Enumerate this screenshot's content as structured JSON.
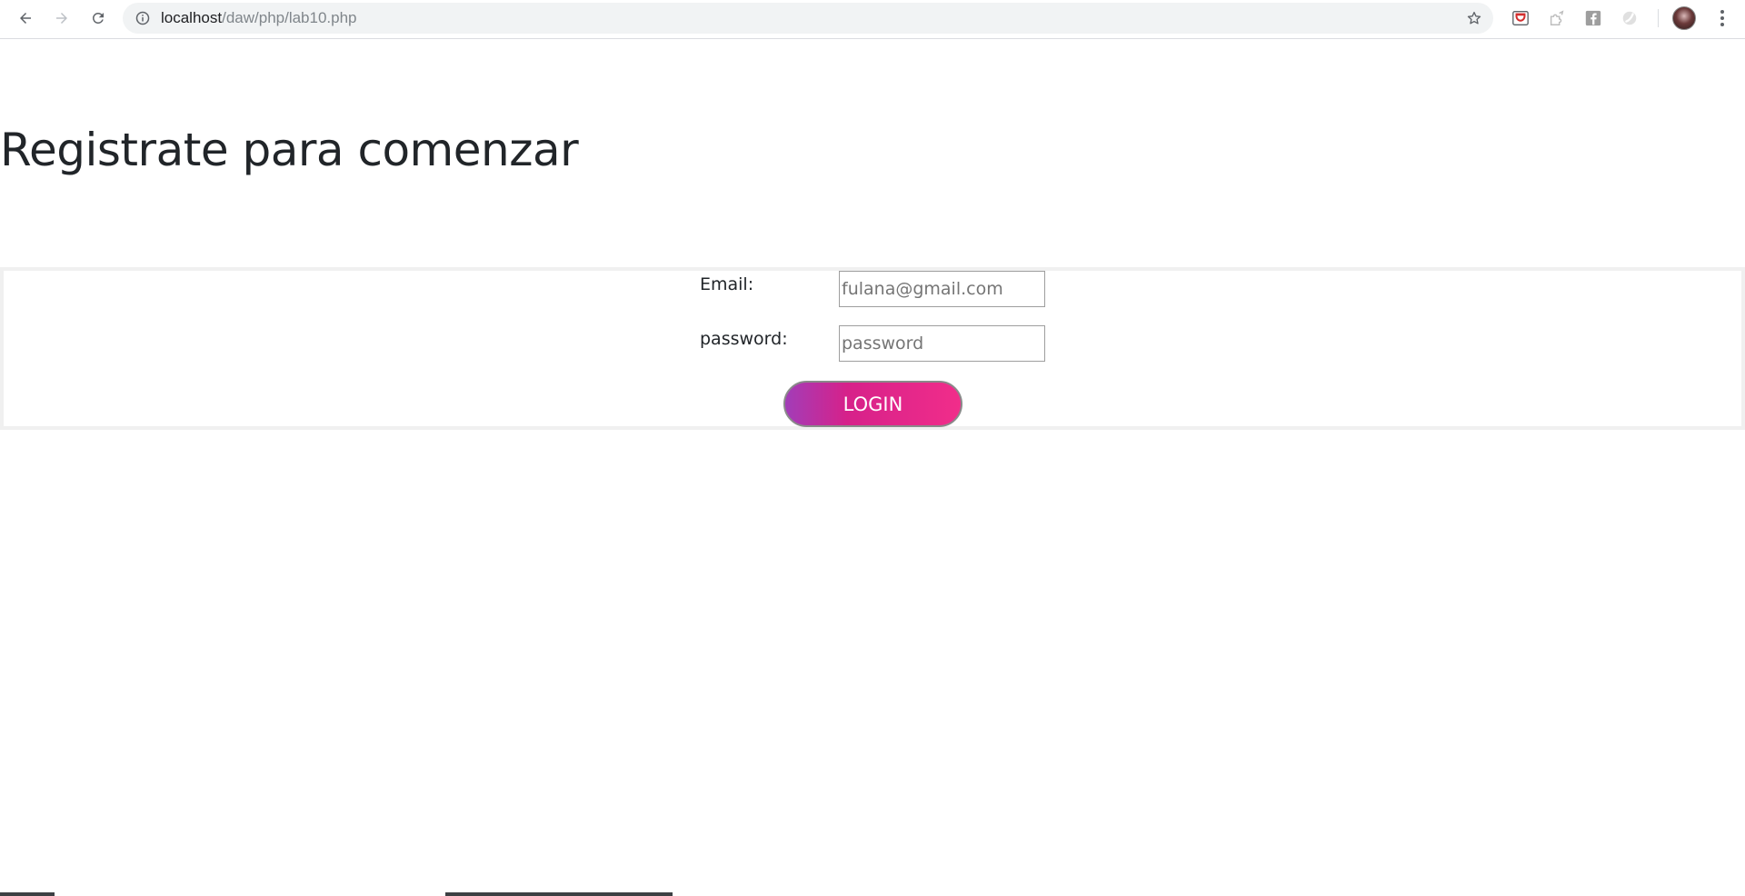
{
  "browser": {
    "url_host": "localhost",
    "url_path": "/daw/php/lab10.php",
    "icons": {
      "back": "back-arrow-icon",
      "forward": "forward-arrow-icon",
      "reload": "reload-icon",
      "info": "info-icon",
      "bookmark": "star-icon",
      "extensions": [
        "pocket-extension-icon",
        "puzzle-extension-icon",
        "facebook-extension-icon",
        "grey-extension-icon"
      ],
      "menu": "more-vert-icon"
    }
  },
  "page": {
    "title": "Registrate para comenzar"
  },
  "form": {
    "email_label": "Email:",
    "email_placeholder": "fulana@gmail.com",
    "password_label": "password:",
    "password_placeholder": "password",
    "submit_label": "LOGIN"
  },
  "colors": {
    "button_gradient_start": "#a23db8",
    "button_gradient_end": "#f12d8a",
    "title_text": "#212529"
  }
}
